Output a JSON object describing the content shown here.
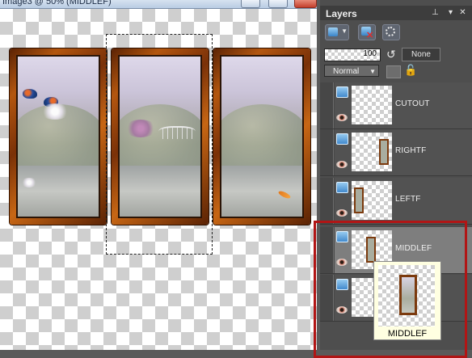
{
  "canvas_window": {
    "title": "Image3 @ 50% (MIDDLEF)"
  },
  "layers_palette": {
    "title": "Layers",
    "opacity": "100",
    "blend_group": "None",
    "blend_mode": "Normal",
    "layers": [
      {
        "name": "CUTOUT"
      },
      {
        "name": "RIGHTF"
      },
      {
        "name": "LEFTF"
      },
      {
        "name": "MIDDLEF"
      },
      {
        "name": ""
      }
    ],
    "selected_layer": "MIDDLEF"
  },
  "drag_tooltip": {
    "label": "MIDDLEF"
  },
  "colors": {
    "frame_brown": "#b3560f",
    "palette_bg": "#4e4e4e",
    "selected_row": "#7e7e7e",
    "highlight_red": "#b11515",
    "tooltip_bg": "#ffffe1"
  },
  "icons": [
    "pin-icon",
    "autohide-icon",
    "close-icon",
    "new-layer-icon",
    "delete-layer-icon",
    "mask-icon",
    "link-icon",
    "lock-icon",
    "eye-icon",
    "layer-type-icon"
  ]
}
